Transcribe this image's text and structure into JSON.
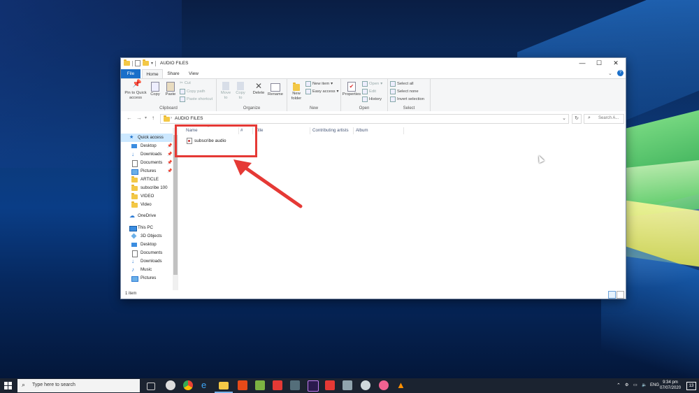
{
  "window": {
    "title": "AUDIO FILES",
    "controls": {
      "minimize": "—",
      "maximize": "☐",
      "close": "✕"
    }
  },
  "tabs": [
    "File",
    "Home",
    "Share",
    "View"
  ],
  "ribbon": {
    "clipboard": {
      "label": "Clipboard",
      "pin": "Pin to Quick access",
      "copy": "Copy",
      "paste": "Paste",
      "cut": "Cut",
      "copy_path": "Copy path",
      "paste_shortcut": "Paste shortcut"
    },
    "organize": {
      "label": "Organize",
      "move_to": "Move to",
      "copy_to": "Copy to",
      "delete": "Delete",
      "rename": "Rename"
    },
    "new": {
      "label": "New",
      "new_folder": "New folder",
      "new_item": "New item",
      "easy_access": "Easy access"
    },
    "open": {
      "label": "Open",
      "properties": "Properties",
      "open": "Open",
      "edit": "Edit",
      "history": "History"
    },
    "select": {
      "label": "Select",
      "select_all": "Select all",
      "select_none": "Select none",
      "invert_selection": "Invert selection"
    }
  },
  "address": {
    "path": "AUDIO FILES",
    "search_placeholder": "Search A..."
  },
  "navpane": {
    "quick_access": "Quick access",
    "quick_items": [
      "Desktop",
      "Downloads",
      "Documents",
      "Pictures",
      "ARTICLE",
      "subscribe 100",
      "VIDEO",
      "Video"
    ],
    "onedrive": "OneDrive",
    "this_pc": "This PC",
    "pc_items": [
      "3D Objects",
      "Desktop",
      "Documents",
      "Downloads",
      "Music",
      "Pictures"
    ]
  },
  "columns": [
    "Name",
    "#",
    "Title",
    "Contributing artists",
    "Album"
  ],
  "files": [
    {
      "name": "subscribe audio"
    }
  ],
  "status": {
    "count": "1 item"
  },
  "taskbar": {
    "search_placeholder": "Type here to search",
    "lang": "ENG",
    "time": "9:34 pm",
    "date": "07/07/2020",
    "notifications": "13"
  },
  "colors": {
    "accent": "#1a6fc9",
    "highlight": "#e53935"
  }
}
